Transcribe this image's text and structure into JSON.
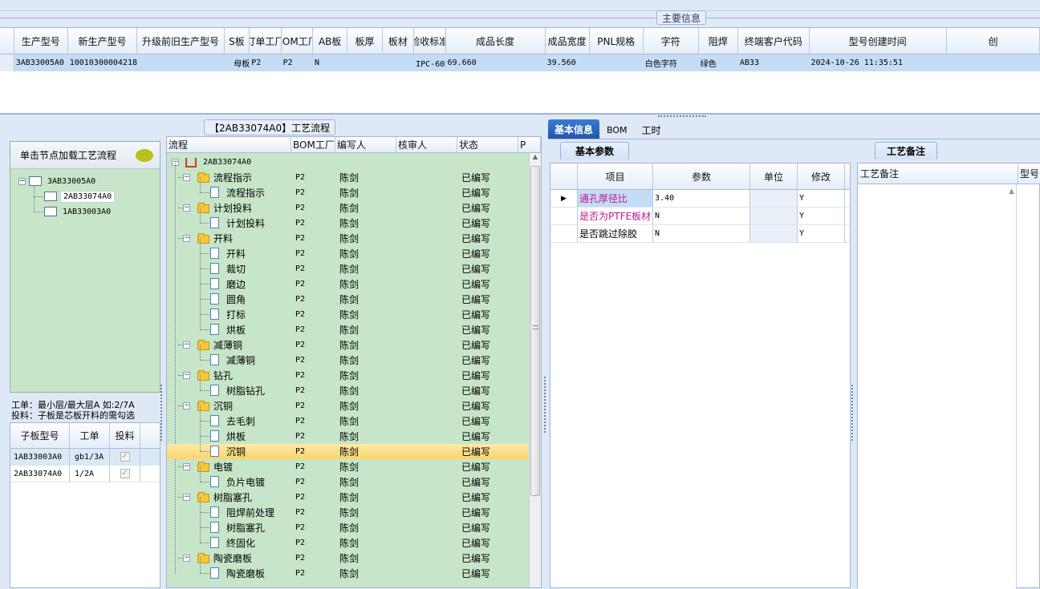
{
  "top": {
    "section_title": "主要信息",
    "columns": [
      "生产型号",
      "新生产型号",
      "升级前旧生产型号",
      "S板",
      "订单工厂",
      "BOM工厂",
      "AB板",
      "板厚",
      "板材",
      "验收标准",
      "成品长度",
      "成品宽度",
      "PNL规格",
      "字符",
      "阻焊",
      "终端客户代码",
      "型号创建时间",
      "创"
    ],
    "row": [
      "3AB33005A0",
      "10010300004218",
      "母板",
      "P2",
      "P2",
      "N",
      "",
      "",
      "IPC-6018 Ⅱ级",
      "69.660",
      "39.560",
      "",
      "白色字符",
      "绿色",
      "AB33",
      "2024-10-26 11:35:51"
    ]
  },
  "left": {
    "vertical_tab": "结构",
    "load_hint": "单击节点加载工艺流程",
    "tree": [
      "3AB33005A0",
      "2AB33074A0",
      "1AB33003A0"
    ],
    "note1": "工单：最小层/最大层A 如:2/7A",
    "note2": "投料：子板是芯板开料的需勾选",
    "sub_headers": [
      "子板型号",
      "工单",
      "投料"
    ],
    "sub_rows": [
      {
        "model": "1AB33003A0",
        "order": "gb1/3A",
        "feed": "✓"
      },
      {
        "model": "2AB33074A0",
        "order": "1/2A",
        "feed": "✓"
      }
    ]
  },
  "flow": {
    "title": "【2AB33074A0】工艺流程",
    "headers": [
      "流程",
      "BOM工厂",
      "编写人",
      "核审人",
      "状态",
      "P"
    ],
    "root": "2AB33074A0",
    "rows": [
      {
        "name": "流程指示",
        "lvl": 1,
        "bom": "P2",
        "writer": "陈剑",
        "status": "已编写"
      },
      {
        "name": "流程指示",
        "lvl": 2,
        "bom": "P2",
        "writer": "陈剑",
        "status": "已编写"
      },
      {
        "name": "计划投料",
        "lvl": 1,
        "bom": "P2",
        "writer": "陈剑",
        "status": "已编写"
      },
      {
        "name": "计划投料",
        "lvl": 2,
        "bom": "P2",
        "writer": "陈剑",
        "status": "已编写"
      },
      {
        "name": "开料",
        "lvl": 1,
        "bom": "P2",
        "writer": "陈剑",
        "status": "已编写"
      },
      {
        "name": "开料",
        "lvl": 2,
        "bom": "P2",
        "writer": "陈剑",
        "status": "已编写"
      },
      {
        "name": "裁切",
        "lvl": 2,
        "bom": "P2",
        "writer": "陈剑",
        "status": "已编写"
      },
      {
        "name": "磨边",
        "lvl": 2,
        "bom": "P2",
        "writer": "陈剑",
        "status": "已编写"
      },
      {
        "name": "圆角",
        "lvl": 2,
        "bom": "P2",
        "writer": "陈剑",
        "status": "已编写"
      },
      {
        "name": "打标",
        "lvl": 2,
        "bom": "P2",
        "writer": "陈剑",
        "status": "已编写"
      },
      {
        "name": "烘板",
        "lvl": 2,
        "bom": "P2",
        "writer": "陈剑",
        "status": "已编写"
      },
      {
        "name": "减薄铜",
        "lvl": 1,
        "bom": "P2",
        "writer": "陈剑",
        "status": "已编写"
      },
      {
        "name": "减薄铜",
        "lvl": 2,
        "bom": "P2",
        "writer": "陈剑",
        "status": "已编写"
      },
      {
        "name": "钻孔",
        "lvl": 1,
        "bom": "P2",
        "writer": "陈剑",
        "status": "已编写"
      },
      {
        "name": "树脂钻孔",
        "lvl": 2,
        "bom": "P2",
        "writer": "陈剑",
        "status": "已编写"
      },
      {
        "name": "沉铜",
        "lvl": 1,
        "bom": "P2",
        "writer": "陈剑",
        "status": "已编写"
      },
      {
        "name": "去毛刺",
        "lvl": 2,
        "bom": "P2",
        "writer": "陈剑",
        "status": "已编写"
      },
      {
        "name": "烘板",
        "lvl": 2,
        "bom": "P2",
        "writer": "陈剑",
        "status": "已编写"
      },
      {
        "name": "沉铜",
        "lvl": 2,
        "bom": "P2",
        "writer": "陈剑",
        "status": "已编写",
        "selected": true
      },
      {
        "name": "电镀",
        "lvl": 1,
        "bom": "P2",
        "writer": "陈剑",
        "status": "已编写"
      },
      {
        "name": "负片电镀",
        "lvl": 2,
        "bom": "P2",
        "writer": "陈剑",
        "status": "已编写"
      },
      {
        "name": "树脂塞孔",
        "lvl": 1,
        "bom": "P2",
        "writer": "陈剑",
        "status": "已编写"
      },
      {
        "name": "阻焊前处理",
        "lvl": 2,
        "bom": "P2",
        "writer": "陈剑",
        "status": "已编写"
      },
      {
        "name": "树脂塞孔",
        "lvl": 2,
        "bom": "P2",
        "writer": "陈剑",
        "status": "已编写"
      },
      {
        "name": "终固化",
        "lvl": 2,
        "bom": "P2",
        "writer": "陈剑",
        "status": "已编写"
      },
      {
        "name": "陶瓷磨板",
        "lvl": 1,
        "bom": "P2",
        "writer": "陈剑",
        "status": "已编写"
      },
      {
        "name": "陶瓷磨板",
        "lvl": 2,
        "bom": "P2",
        "writer": "陈剑",
        "status": "已编写"
      }
    ]
  },
  "right": {
    "tabs": [
      "基本信息",
      "BOM",
      "工时"
    ],
    "params_title": "基本参数",
    "params_headers": [
      "项目",
      "参数",
      "单位",
      "修改"
    ],
    "params_rows": [
      {
        "item": "通孔厚径比",
        "value": "3.40",
        "unit": "",
        "mod": "Y",
        "pink": true
      },
      {
        "item": "是否为PTFE板材",
        "value": "N",
        "unit": "",
        "mod": "Y",
        "pink": true
      },
      {
        "item": "是否跳过除胶",
        "value": "N",
        "unit": "",
        "mod": "Y",
        "pink": false
      }
    ],
    "remark_title": "工艺备注",
    "remark_col": "工艺备注",
    "remark_col2": "型号"
  },
  "colors": {
    "grid_green": "#c7e6c9",
    "selected_blue": "#cfe3fa",
    "pink": "#c0168b",
    "header_blue": "#1f5fa8"
  }
}
